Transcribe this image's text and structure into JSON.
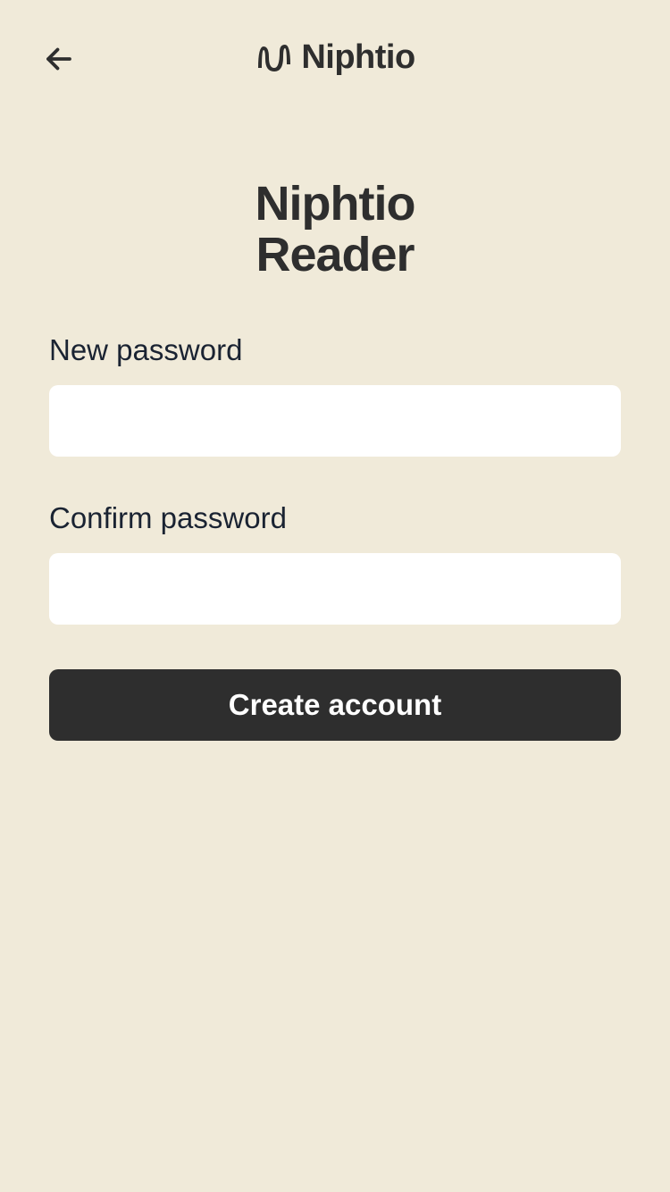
{
  "header": {
    "brand_name": "Niphtio"
  },
  "main": {
    "app_title_line1": "Niphtio",
    "app_title_line2": "Reader",
    "new_password_label": "New password",
    "new_password_value": "",
    "confirm_password_label": "Confirm password",
    "confirm_password_value": "",
    "submit_label": "Create account"
  }
}
